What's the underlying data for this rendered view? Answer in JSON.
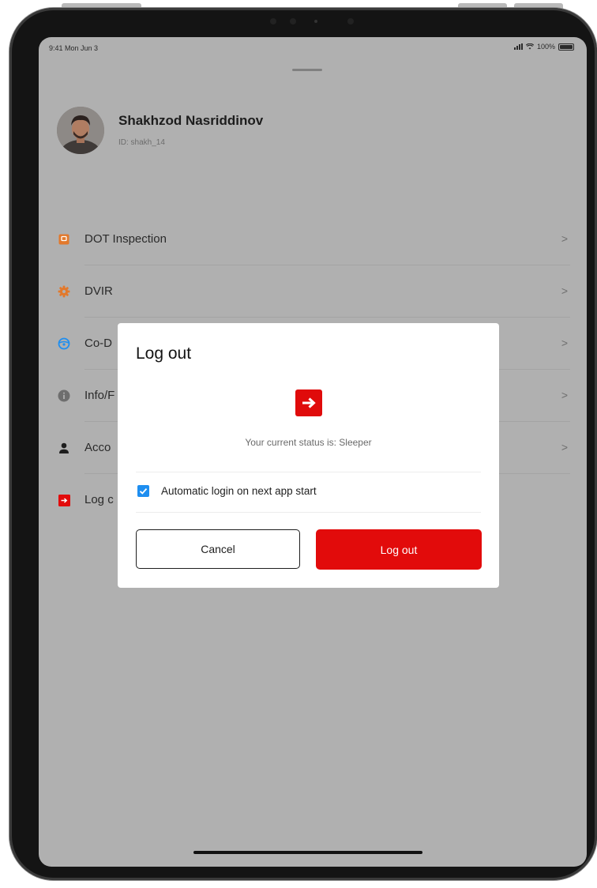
{
  "status_bar": {
    "time": "9:41 Mon Jun 3",
    "battery": "100%"
  },
  "profile": {
    "name": "Shakhzod Nasriddinov",
    "id_label": "ID: shakh_14"
  },
  "menu": {
    "items": [
      {
        "label": "DOT Inspection",
        "icon": "dot-inspection-icon",
        "icon_color": "#e2792c"
      },
      {
        "label": "DVIR",
        "icon": "gear-icon",
        "icon_color": "#e2792c"
      },
      {
        "label": "Co-D",
        "icon": "steering-wheel-icon",
        "icon_color": "#1e8ef0"
      },
      {
        "label": "Info/F",
        "icon": "info-icon",
        "icon_color": "#6e6e6e"
      },
      {
        "label": "Acco",
        "icon": "person-icon",
        "icon_color": "#1e1e1e"
      },
      {
        "label": "Log c",
        "icon": "logout-icon",
        "icon_color": "#e20b0b"
      }
    ],
    "chevron": ">"
  },
  "dialog": {
    "title": "Log out",
    "status_text": "Your current status is: Sleeper",
    "auto_login_label": "Automatic login on next app start",
    "auto_login_checked": true,
    "cancel_label": "Cancel",
    "logout_label": "Log out"
  },
  "colors": {
    "accent_red": "#e20b0b",
    "checkbox_blue": "#1e8ef0",
    "overlay_gray": "#b0b0b0"
  }
}
